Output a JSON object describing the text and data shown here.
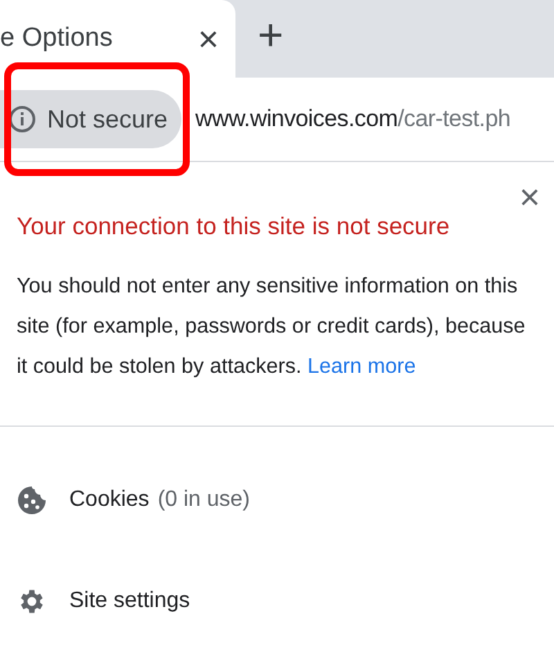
{
  "tab": {
    "title": "e Options",
    "close": "×",
    "new_tab": "+"
  },
  "address_bar": {
    "security_chip": "Not secure",
    "url_host": "www.winvoices.com",
    "url_path": "/car-test.ph",
    "highlighted": true
  },
  "popup": {
    "close": "×",
    "title": "Your connection to this site is not secure",
    "message": "You should not enter any sensitive information on this site (for example, passwords or credit cards), because it could be stolen by attackers.",
    "link": "Learn more",
    "items": [
      {
        "kind": "cookies",
        "label": "Cookies",
        "detail": "(0 in use)"
      },
      {
        "kind": "settings",
        "label": "Site settings"
      }
    ]
  }
}
